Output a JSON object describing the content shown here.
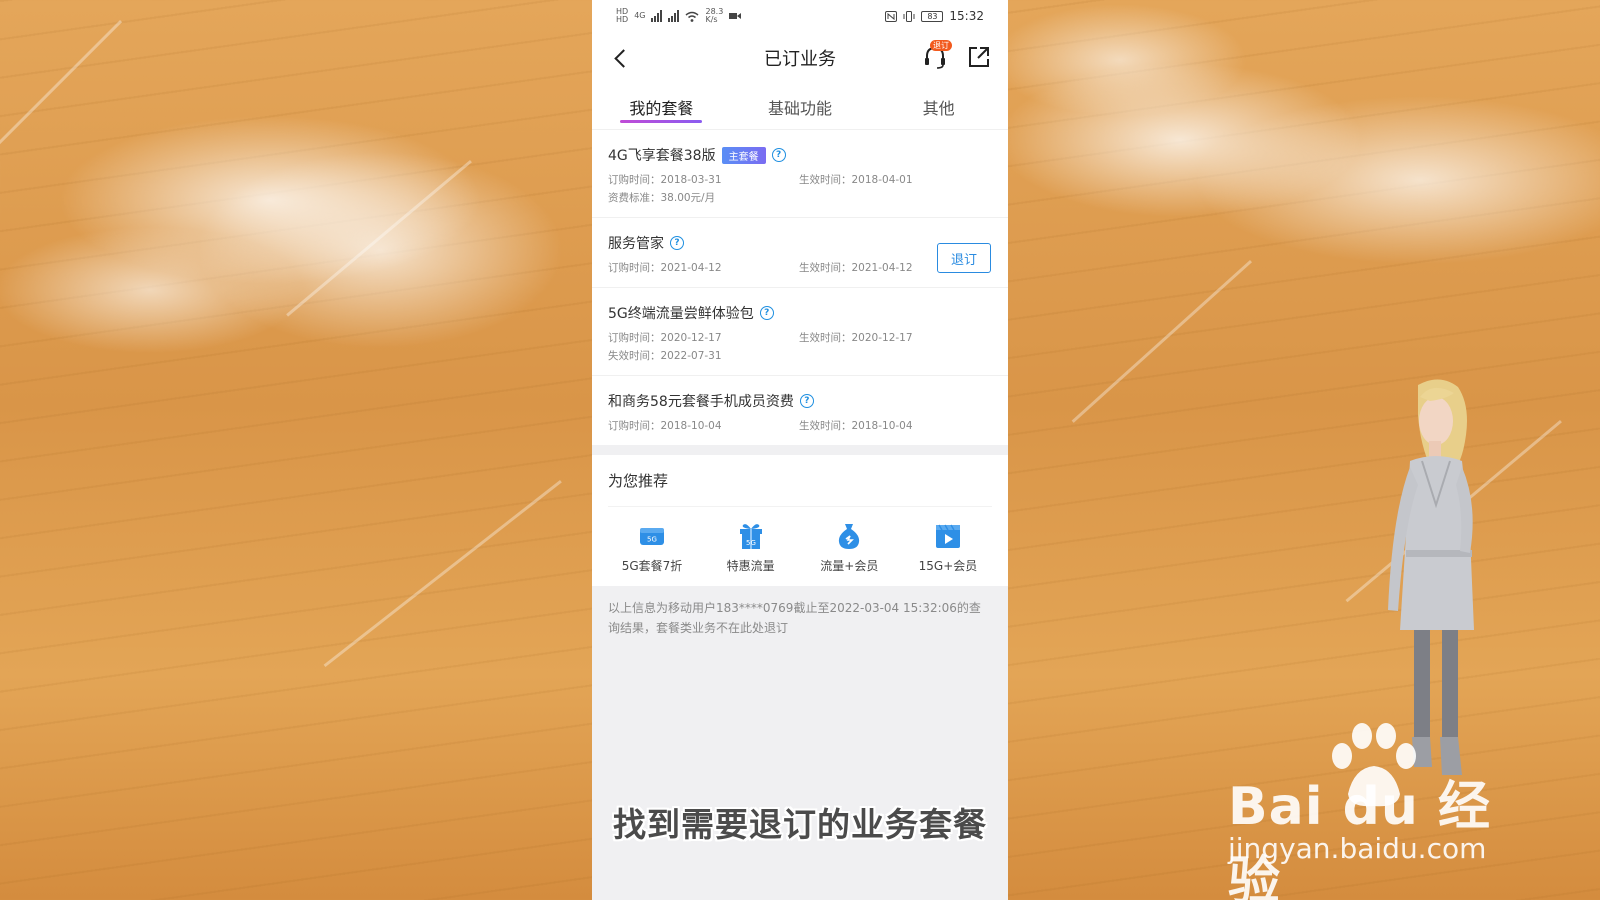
{
  "status_bar": {
    "left_mini": [
      "HD",
      "HD"
    ],
    "network": "4G",
    "speed_value": "28.3",
    "speed_unit": "K/s",
    "battery": "83",
    "time": "15:32"
  },
  "header": {
    "title": "已订业务",
    "badge": "退订"
  },
  "tabs": [
    {
      "label": "我的套餐",
      "active": true
    },
    {
      "label": "基础功能",
      "active": false
    },
    {
      "label": "其他",
      "active": false
    }
  ],
  "businesses": [
    {
      "name": "4G飞享套餐38版",
      "tag": "主套餐",
      "order_time": "订购时间：2018-03-31",
      "effective_time": "生效时间：2018-04-01",
      "extra": "资费标准：38.00元/月"
    },
    {
      "name": "服务管家",
      "order_time": "订购时间：2021-04-12",
      "effective_time": "生效时间：2021-04-12",
      "action": "退订"
    },
    {
      "name": "5G终端流量尝鲜体验包",
      "order_time": "订购时间：2020-12-17",
      "effective_time": "生效时间：2020-12-17",
      "extra": "失效时间：2022-07-31"
    },
    {
      "name": "和商务58元套餐手机成员资费",
      "order_time": "订购时间：2018-10-04",
      "effective_time": "生效时间：2018-10-04"
    }
  ],
  "recommend": {
    "title": "为您推荐",
    "items": [
      {
        "label": "5G套餐7折",
        "icon": "5g-card-icon",
        "icon_text": "5G"
      },
      {
        "label": "特惠流量",
        "icon": "gift-5g-icon",
        "icon_text": "5G"
      },
      {
        "label": "流量+会员",
        "icon": "money-bag-icon"
      },
      {
        "label": "15G+会员",
        "icon": "video-play-icon"
      }
    ]
  },
  "footer_note": "以上信息为移动用户183****0769截止至2022-03-04 15:32:06的查询结果，套餐类业务不在此处退订",
  "caption": "找到需要退订的业务套餐",
  "watermark": {
    "logo": "Bai du 经验",
    "url": "jingyan.baidu.com"
  },
  "colors": {
    "accent_blue": "#2a8be0",
    "tab_underline": "#c04bd6",
    "badge_orange": "#f25a1d"
  }
}
